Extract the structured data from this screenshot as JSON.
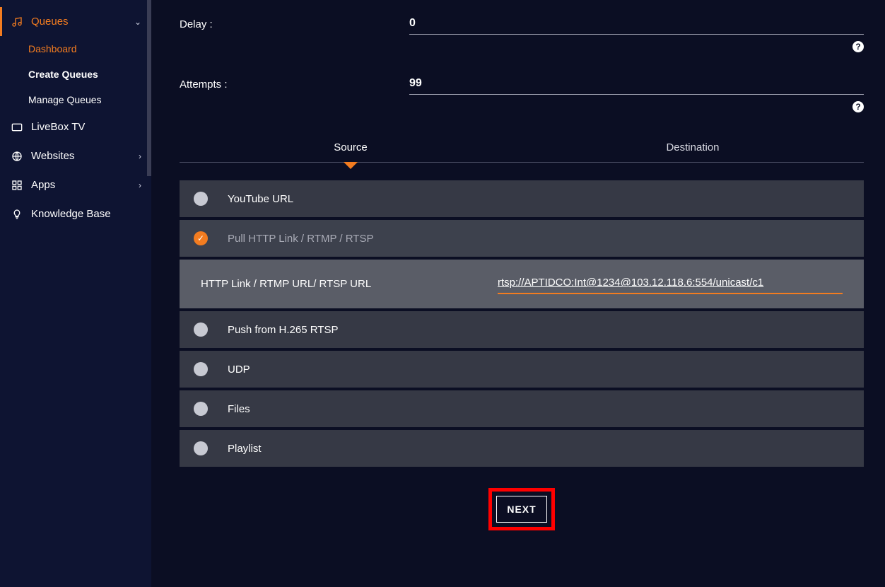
{
  "sidebar": {
    "queues": {
      "label": "Queues"
    },
    "subitems": [
      {
        "label": "Dashboard"
      },
      {
        "label": "Create Queues"
      },
      {
        "label": "Manage Queues"
      }
    ],
    "liveboxtv": {
      "label": "LiveBox TV"
    },
    "websites": {
      "label": "Websites"
    },
    "apps": {
      "label": "Apps"
    },
    "knowledge": {
      "label": "Knowledge Base"
    }
  },
  "form": {
    "delay_label": "Delay :",
    "delay_value": "0",
    "attempts_label": "Attempts :",
    "attempts_value": "99"
  },
  "tabs": {
    "source": "Source",
    "destination": "Destination"
  },
  "sources": {
    "youtube": "YouTube URL",
    "pull": "Pull HTTP Link / RTMP / RTSP",
    "detail_label": "HTTP Link / RTMP URL/ RTSP URL",
    "detail_value": "rtsp://APTIDCO:Int@1234@103.12.118.6:554/unicast/c1",
    "push": "Push from H.265 RTSP",
    "udp": "UDP",
    "files": "Files",
    "playlist": "Playlist"
  },
  "next_button": "NEXT"
}
